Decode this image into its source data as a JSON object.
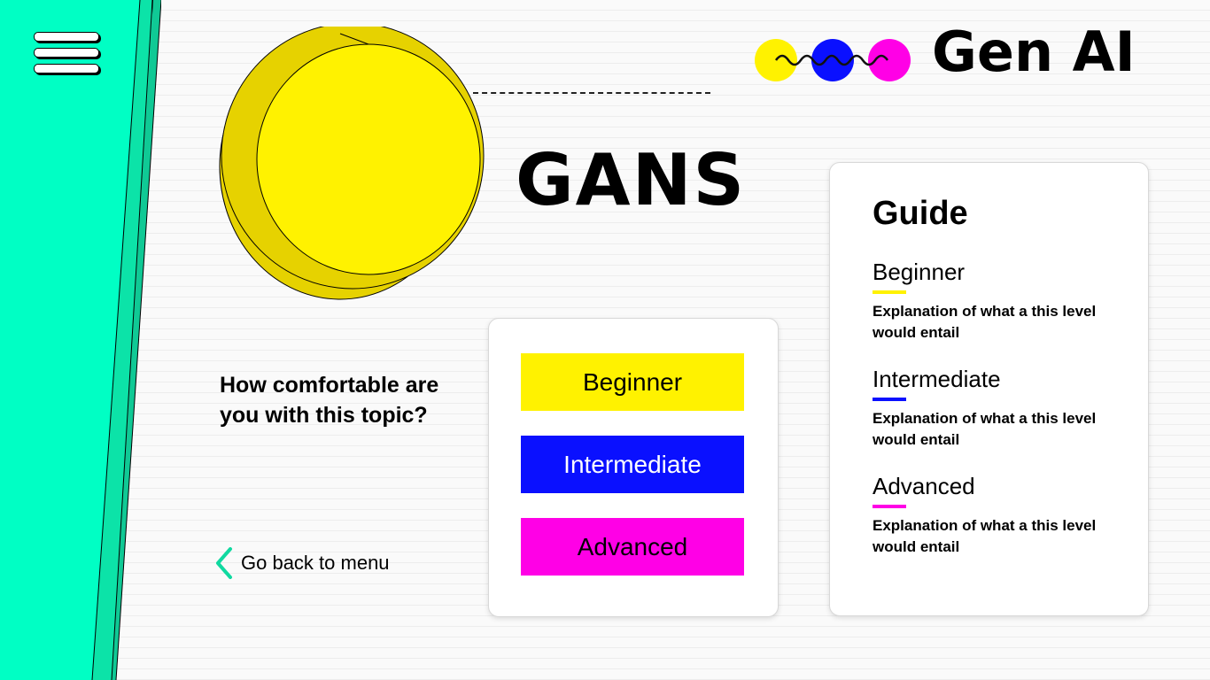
{
  "app": {
    "logo_text": "Gen AI",
    "logo_dots": [
      "yellow-dot",
      "blue-dot",
      "magenta-dot"
    ]
  },
  "colors": {
    "sidebar": "#00ffc4",
    "beginner": "#fff200",
    "intermediate": "#0a10ff",
    "advanced": "#ff00e6"
  },
  "page": {
    "title": "GANS",
    "question": "How comfortable are you with this topic?",
    "back_label": "Go back to menu"
  },
  "levels": [
    {
      "label": "Beginner"
    },
    {
      "label": "Intermediate"
    },
    {
      "label": "Advanced"
    }
  ],
  "guide": {
    "title": "Guide",
    "items": [
      {
        "label": "Beginner",
        "description": "Explanation of what a this level would entail"
      },
      {
        "label": "Intermediate",
        "description": "Explanation of what a this level would entail"
      },
      {
        "label": "Advanced",
        "description": "Explanation of what a this level would entail"
      }
    ]
  },
  "icons": {
    "menu": "hamburger-menu-icon",
    "back": "chevron-left-icon"
  }
}
